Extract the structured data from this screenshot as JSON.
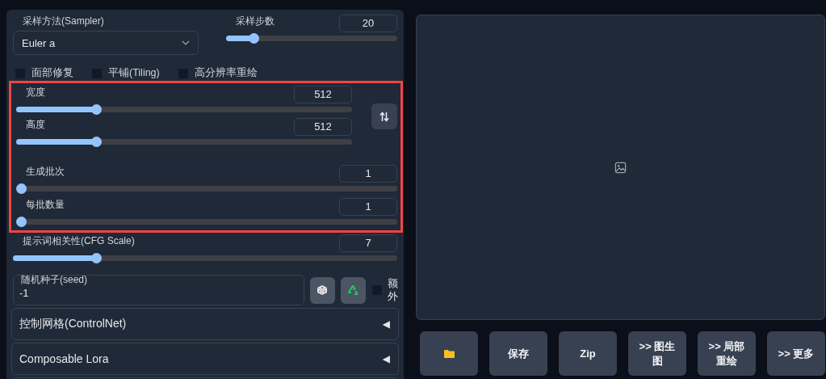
{
  "sampler": {
    "label": "采样方法(Sampler)",
    "value": "Euler a"
  },
  "steps_slider": {
    "label": "采样步数",
    "value": "20",
    "level": 0.14
  },
  "options": [
    {
      "label": "面部修复",
      "checked": false
    },
    {
      "label": "平铺(Tiling)",
      "checked": false
    },
    {
      "label": "高分辨率重绘",
      "checked": false
    }
  ],
  "size_sliders": [
    {
      "label": "宽度",
      "value": "512",
      "level": 0.23
    },
    {
      "label": "高度",
      "value": "512",
      "level": 0.23
    }
  ],
  "batch_sliders": [
    {
      "label": "生成批次",
      "value": "1",
      "level": 0
    },
    {
      "label": "每批数量",
      "value": "1",
      "level": 0
    }
  ],
  "cfg_slider": {
    "label": "提示词相关性(CFG Scale)",
    "value": "7",
    "level": 0.21
  },
  "seed": {
    "label": "随机种子(seed)",
    "value": "-1",
    "extra_label": "额外",
    "extra_checked": false
  },
  "accordions": [
    {
      "title": "控制网格(ControlNet)",
      "arrow": "◀",
      "expanded": false
    },
    {
      "title": "Composable Lora",
      "arrow": "◀",
      "expanded": false
    }
  ],
  "output_buttons": [
    {
      "kind": "folder"
    },
    {
      "kind": "text",
      "label": "保存"
    },
    {
      "kind": "text",
      "label": "Zip"
    },
    {
      "kind": "text",
      "label": ">> 图生图"
    },
    {
      "kind": "text",
      "label": ">> 局部重绘"
    },
    {
      "kind": "text",
      "label": ">> 更多"
    }
  ]
}
